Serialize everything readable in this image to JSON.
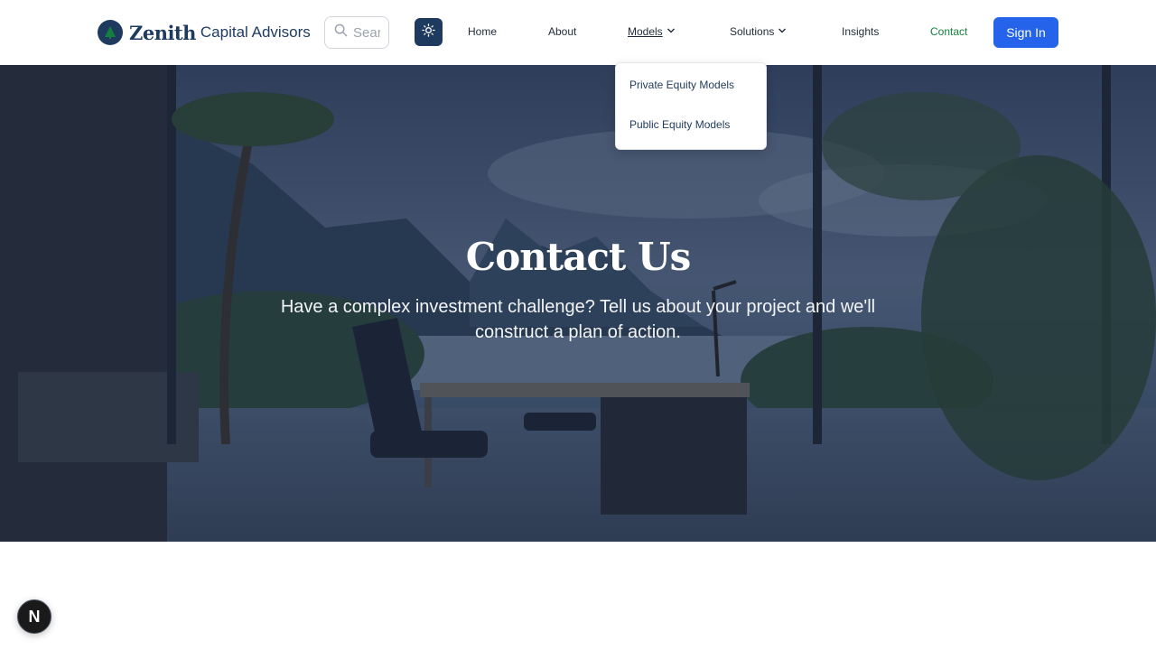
{
  "brand": {
    "name": "Zenith",
    "subtitle": "Capital Advisors"
  },
  "search": {
    "placeholder": "Search"
  },
  "nav": {
    "home": "Home",
    "about": "About",
    "models": "Models",
    "solutions": "Solutions",
    "insights": "Insights",
    "contact": "Contact",
    "sign_in": "Sign In"
  },
  "models_dropdown": {
    "items": [
      "Private Equity Models",
      "Public Equity Models"
    ]
  },
  "hero": {
    "title": "Contact Us",
    "subtitle": "Have a complex investment challenge? Tell us about your project and we'll construct a plan of action."
  },
  "dev_badge": {
    "label": "N"
  },
  "colors": {
    "brand_navy": "#1e3a5f",
    "primary_button": "#2563eb",
    "contact_link": "#15803d"
  },
  "icons": {
    "logo": "tree-logo-icon",
    "search": "search-icon",
    "theme": "sun-icon",
    "chevron": "chevron-down-icon"
  }
}
